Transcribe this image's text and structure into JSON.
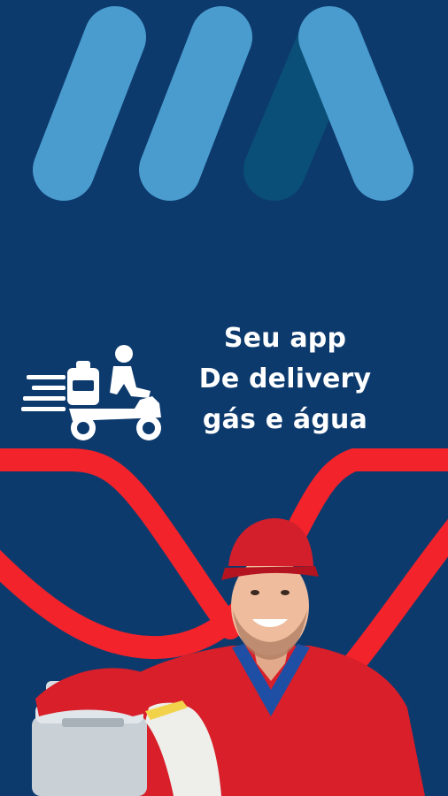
{
  "colors": {
    "background": "#0d3a6d",
    "logo_light_blue": "#4a9ccf",
    "logo_dark_blue": "#0a4f78",
    "accent_red": "#f2232b",
    "text": "#ffffff"
  },
  "hero": {
    "tagline": {
      "line1": "Seu app",
      "line2": "De delivery",
      "line3": "gás e água"
    }
  },
  "icons": {
    "logo": "brand-logo",
    "delivery": "delivery-scooter-icon"
  },
  "illustration": {
    "subject": "delivery-person-with-gas-cylinder"
  }
}
